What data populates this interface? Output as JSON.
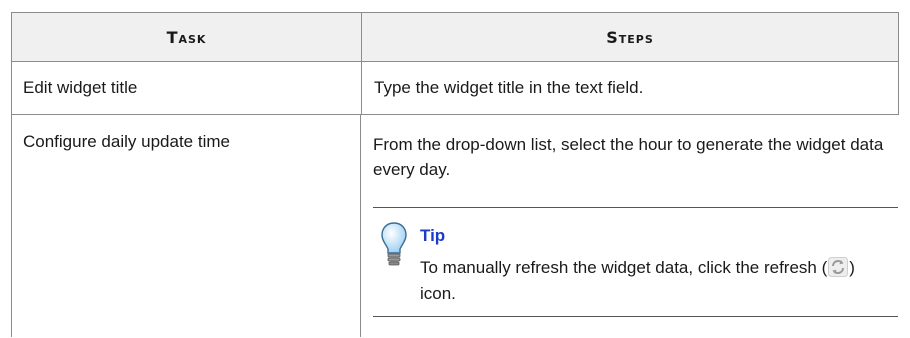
{
  "table": {
    "headers": {
      "task": "Task",
      "steps": "Steps"
    },
    "rows": [
      {
        "task": "Edit widget title",
        "steps": "Type the widget title in the text field."
      },
      {
        "task": "Configure daily update time",
        "steps": "From the drop-down list, select the hour to generate the widget data every day.",
        "tip": {
          "icon": "lightbulb-icon",
          "title": "Tip",
          "text_before": "To manually refresh the widget data, click the refresh (",
          "inline_icon": "refresh-icon",
          "text_after": ") icon."
        }
      }
    ]
  },
  "colors": {
    "header_bg": "#f0f0f0",
    "border": "#8c8c8c",
    "tip_title": "#1a3cc8",
    "bulb": "#bfe0f7"
  }
}
